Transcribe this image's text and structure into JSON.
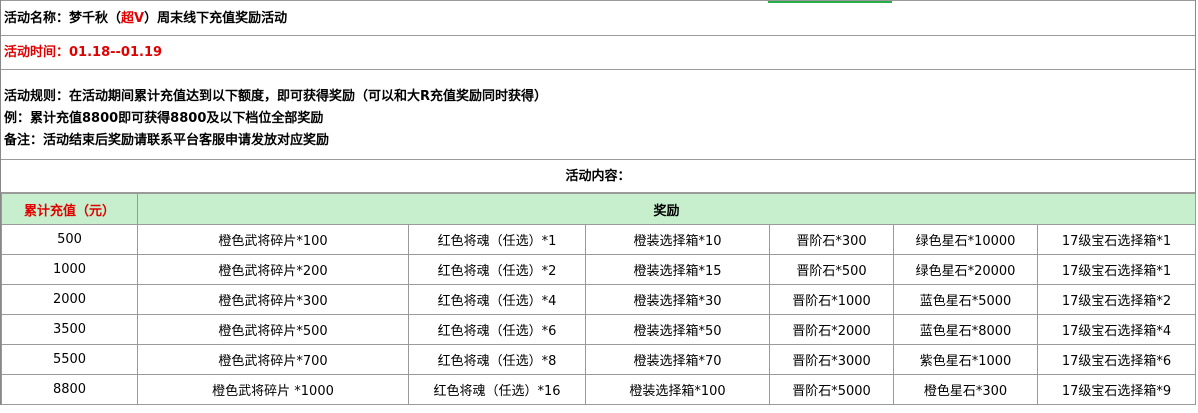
{
  "header": {
    "name_prefix": "活动名称：梦千秋（",
    "name_highlight": "超V",
    "name_suffix": "）周末线下充值奖励活动",
    "time": "活动时间：01.18--01.19",
    "rules": [
      "活动规则：在活动期间累计充值达到以下额度，即可获得奖励（可以和大R充值奖励同时获得）",
      "例：累计充值8800即可获得8800及以下档位全部奖励",
      "备注：活动结束后奖励请联系平台客服申请发放对应奖励"
    ],
    "content_label": "活动内容："
  },
  "table": {
    "col_recharge": "累计充值（元）",
    "col_reward": "奖励",
    "rows": [
      {
        "amount": "500",
        "r1": "橙色武将碎片*100",
        "r2": "红色将魂（任选）*1",
        "r3": "橙装选择箱*10",
        "r4": "晋阶石*300",
        "r5": "绿色星石*10000",
        "r6": "17级宝石选择箱*1"
      },
      {
        "amount": "1000",
        "r1": "橙色武将碎片*200",
        "r2": "红色将魂（任选）*2",
        "r3": "橙装选择箱*15",
        "r4": "晋阶石*500",
        "r5": "绿色星石*20000",
        "r6": "17级宝石选择箱*1"
      },
      {
        "amount": "2000",
        "r1": "橙色武将碎片*300",
        "r2": "红色将魂（任选）*4",
        "r3": "橙装选择箱*30",
        "r4": "晋阶石*1000",
        "r5": "蓝色星石*5000",
        "r6": "17级宝石选择箱*2"
      },
      {
        "amount": "3500",
        "r1": "橙色武将碎片*500",
        "r2": "红色将魂（任选）*6",
        "r3": "橙装选择箱*50",
        "r4": "晋阶石*2000",
        "r5": "蓝色星石*8000",
        "r6": "17级宝石选择箱*4"
      },
      {
        "amount": "5500",
        "r1": "橙色武将碎片*700",
        "r2": "红色将魂（任选）*8",
        "r3": "橙装选择箱*70",
        "r4": "晋阶石*3000",
        "r5": "紫色星石*1000",
        "r6": "17级宝石选择箱*6"
      },
      {
        "amount": "8800",
        "r1": "橙色武将碎片 *1000",
        "r2": "红色将魂（任选）*16",
        "r3": "橙装选择箱*100",
        "r4": "晋阶石*5000",
        "r5": "橙色星石*300",
        "r6": "17级宝石选择箱*9"
      }
    ]
  }
}
